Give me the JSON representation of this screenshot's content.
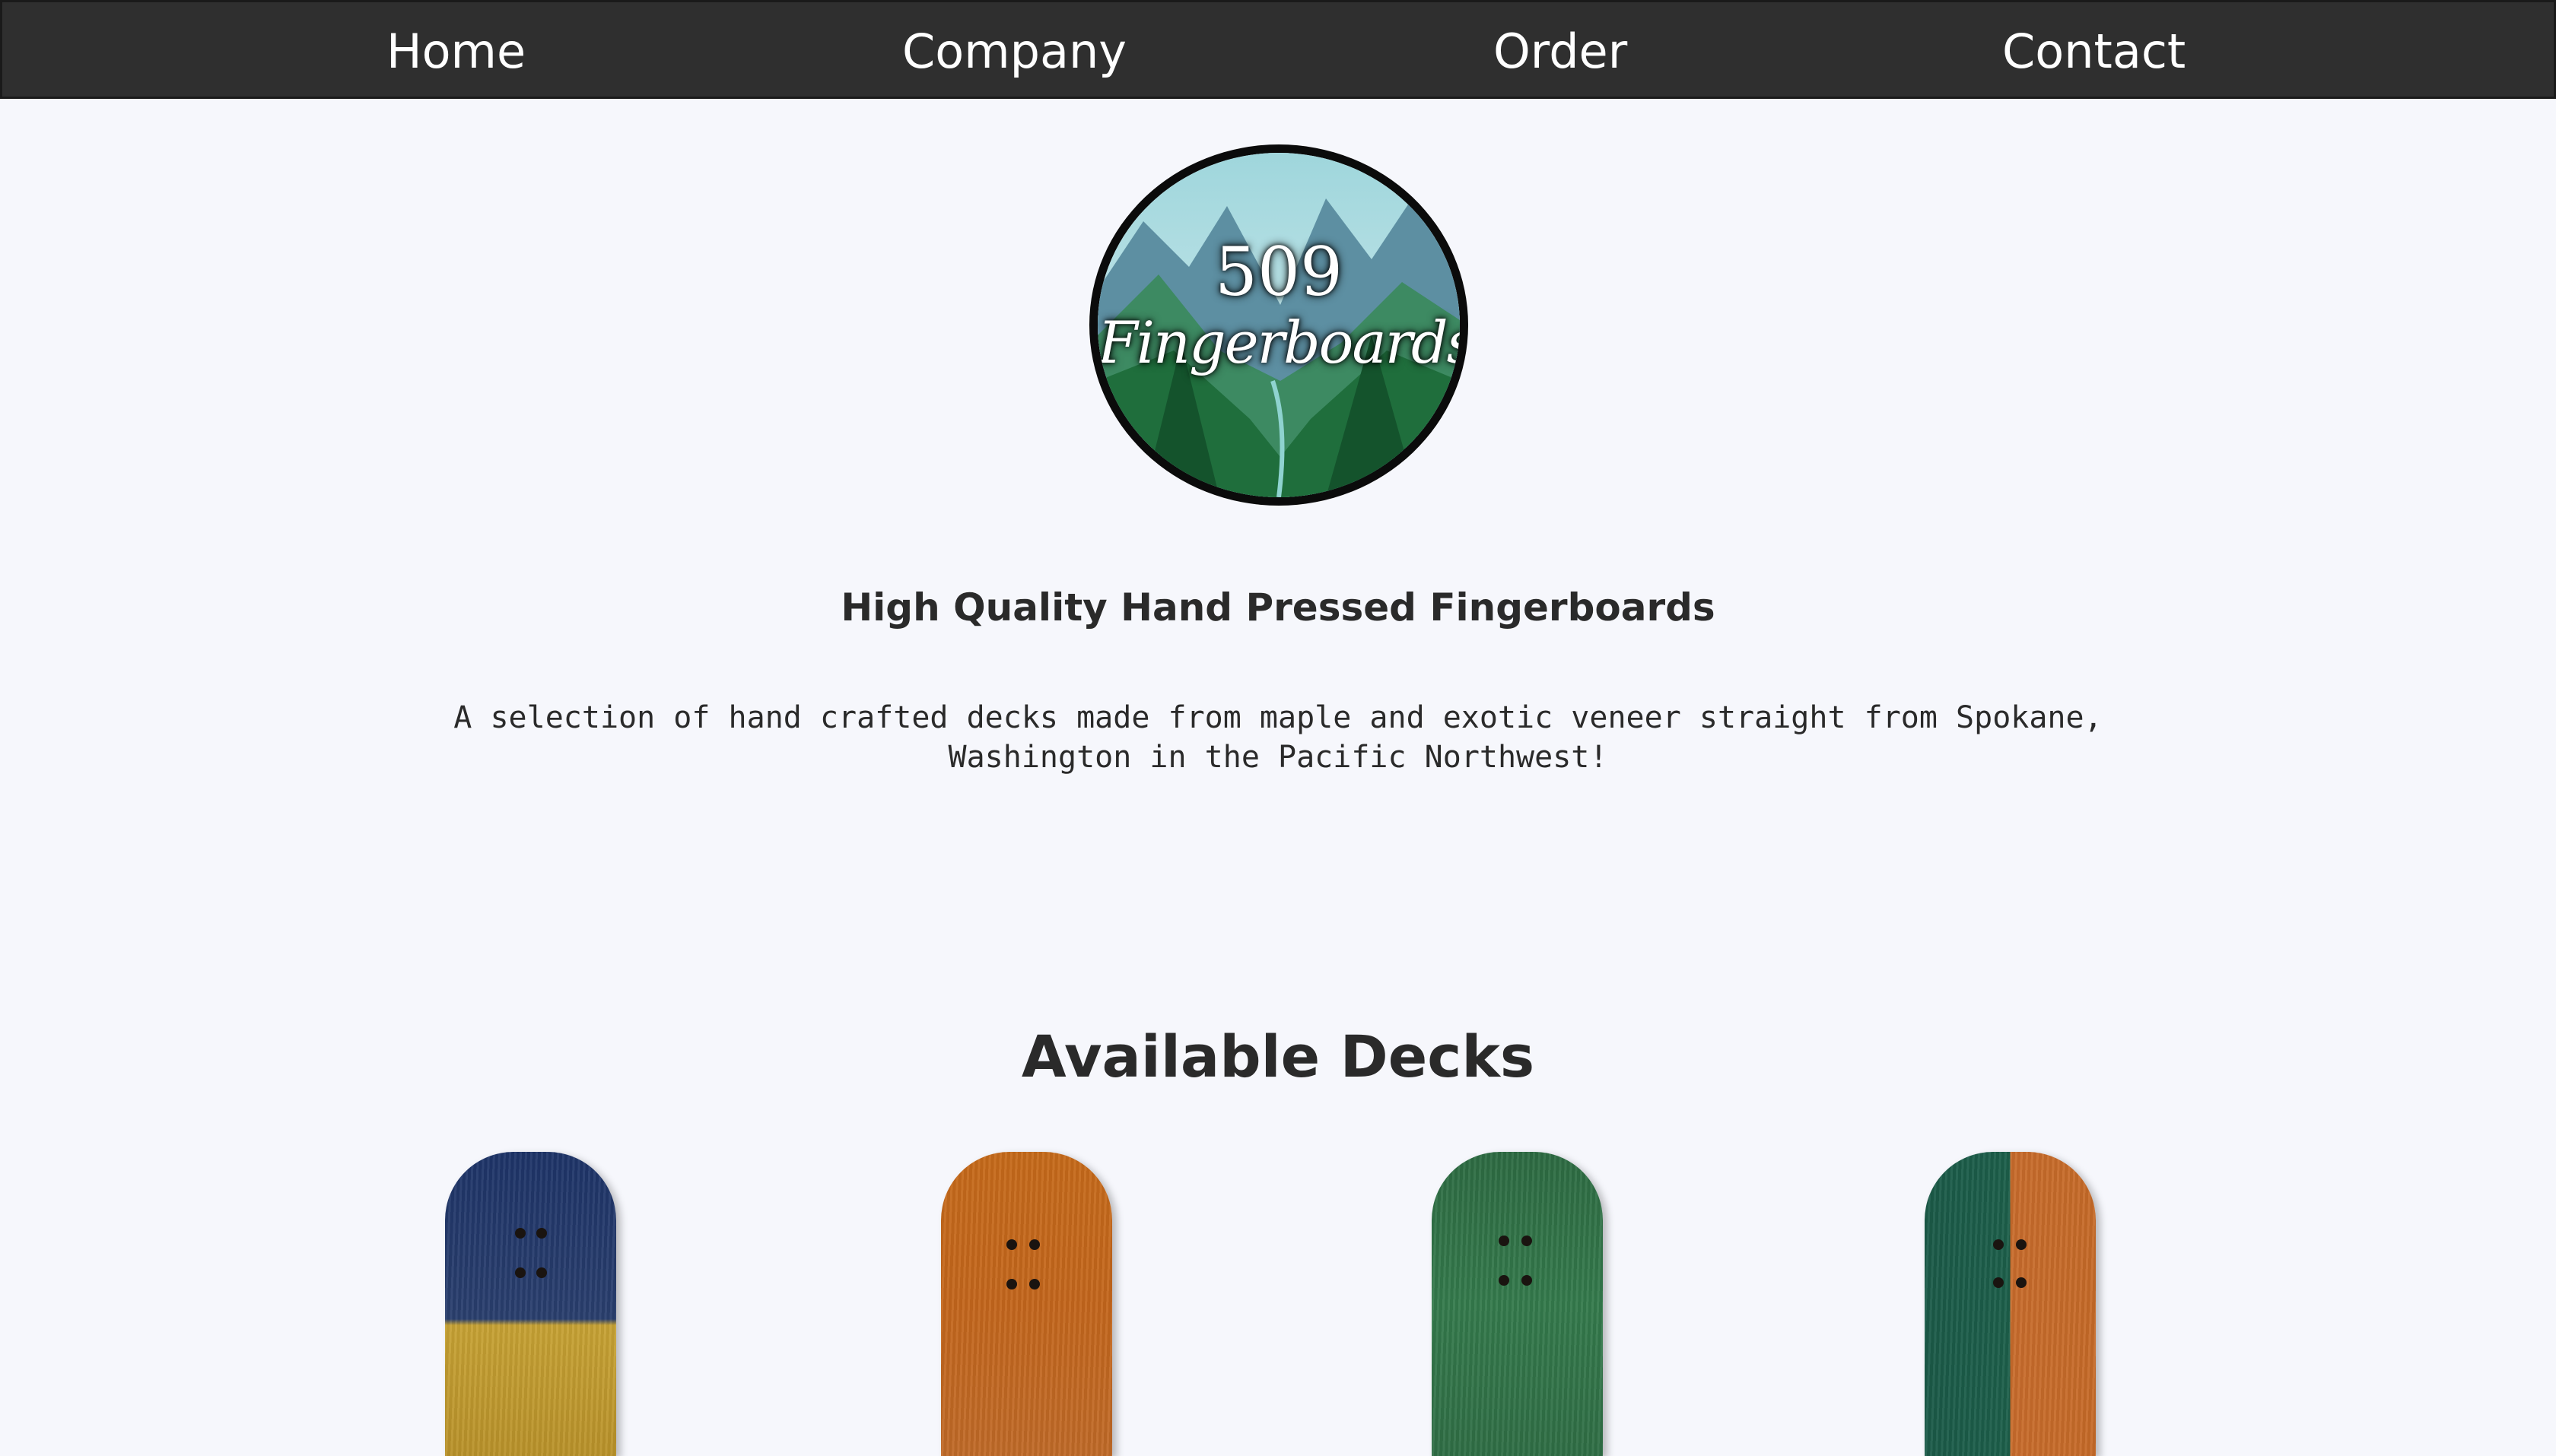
{
  "nav": {
    "home": "Home",
    "company": "Company",
    "order": "Order",
    "contact": "Contact"
  },
  "logo": {
    "number": "509",
    "name": "Fingerboards"
  },
  "hero": {
    "tagline": "High Quality Hand Pressed Fingerboards",
    "description": "A selection of hand crafted decks made from maple and exotic veneer straight from Spokane, Washington in the Pacific Northwest!"
  },
  "decks_section": {
    "title": "Available Decks"
  },
  "colors": {
    "navbar": "#2f2f2f",
    "background": "#f6f7fc",
    "text": "#2a2a2a"
  }
}
